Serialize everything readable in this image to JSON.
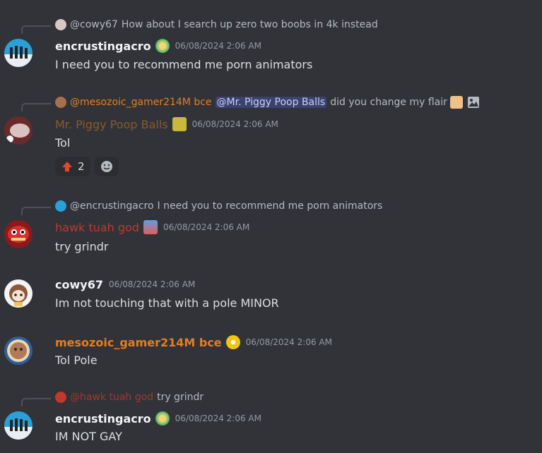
{
  "messages": [
    {
      "reply": {
        "name": "@cowy67",
        "text": "How about I search up zero two boobs in 4k instead"
      },
      "user": "encrustingacro",
      "user_color": "#f2f3f5",
      "time": "06/08/2024 2:06 AM",
      "text": "I need you to recommend me porn animators"
    },
    {
      "reply": {
        "name": "@mesozoic_gamer214M bce",
        "mention": "@Mr. Piggy Poop Balls",
        "text": "did you change my flair"
      },
      "user": "Mr. Piggy Poop Balls",
      "user_color": "#8a5a2b",
      "time": "06/08/2024 2:06 AM",
      "text": "Tol",
      "reaction": {
        "emoji": "up-arrow-icon",
        "count": "2"
      }
    },
    {
      "reply": {
        "name": "@encrustingacro",
        "text": "I need you to recommend me porn animators"
      },
      "user": "hawk tuah god",
      "user_color": "#c0392b",
      "time": "06/08/2024 2:06 AM",
      "text": "try grindr"
    },
    {
      "user": "cowy67",
      "user_color": "#f2f3f5",
      "time": "06/08/2024 2:06 AM",
      "text": "Im not touching that with a pole MINOR"
    },
    {
      "user": "mesozoic_gamer214M bce",
      "user_color": "#e67e22",
      "time": "06/08/2024 2:06 AM",
      "text": "Tol Pole"
    },
    {
      "reply": {
        "name": "@hawk tuah god",
        "text": "try grindr"
      },
      "user": "encrustingacro",
      "user_color": "#f2f3f5",
      "time": "06/08/2024 2:06 AM",
      "text": "IM NOT GAY"
    }
  ]
}
